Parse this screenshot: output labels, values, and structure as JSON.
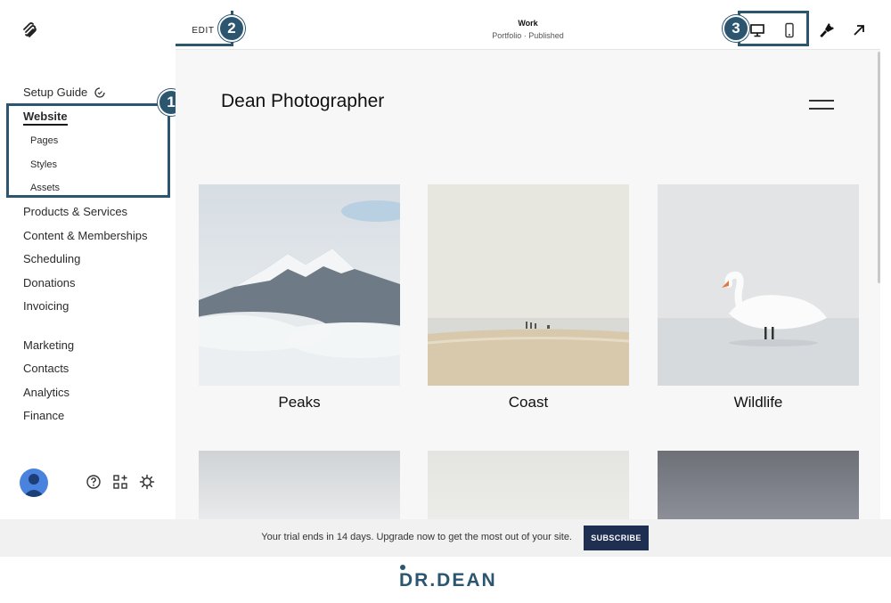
{
  "sidebar": {
    "setup_guide": "Setup Guide",
    "website": "Website",
    "sub_items": [
      "Pages",
      "Styles",
      "Assets"
    ],
    "items_group1": [
      "Products & Services",
      "Content & Memberships",
      "Scheduling",
      "Donations",
      "Invoicing"
    ],
    "items_group2": [
      "Marketing",
      "Contacts",
      "Analytics",
      "Finance"
    ]
  },
  "badges": [
    "1",
    "2",
    "3"
  ],
  "topbar": {
    "edit_label": "EDIT",
    "page_title": "Work",
    "page_status": "Portfolio · Published"
  },
  "site": {
    "title": "Dean Photographer",
    "tiles": [
      {
        "caption": "Peaks"
      },
      {
        "caption": "Coast"
      },
      {
        "caption": "Wildlife"
      }
    ]
  },
  "trial": {
    "message": "Your trial ends in 14 days. Upgrade now to get the most out of your site.",
    "button": "SUBSCRIBE"
  },
  "brand": {
    "letter_d": "D",
    "rest": "R.DEAN"
  },
  "colors": {
    "highlight": "#2c5670",
    "subscribe": "#1f2f52",
    "avatar": "#4a83dd"
  },
  "icons": {
    "logo": "squarespace-logo-icon",
    "desktop": "desktop-icon",
    "mobile": "mobile-icon",
    "design": "paintbrush-icon",
    "open": "arrow-up-right-icon",
    "help": "help-icon",
    "apps": "apps-grid-icon",
    "settings": "gear-icon"
  }
}
